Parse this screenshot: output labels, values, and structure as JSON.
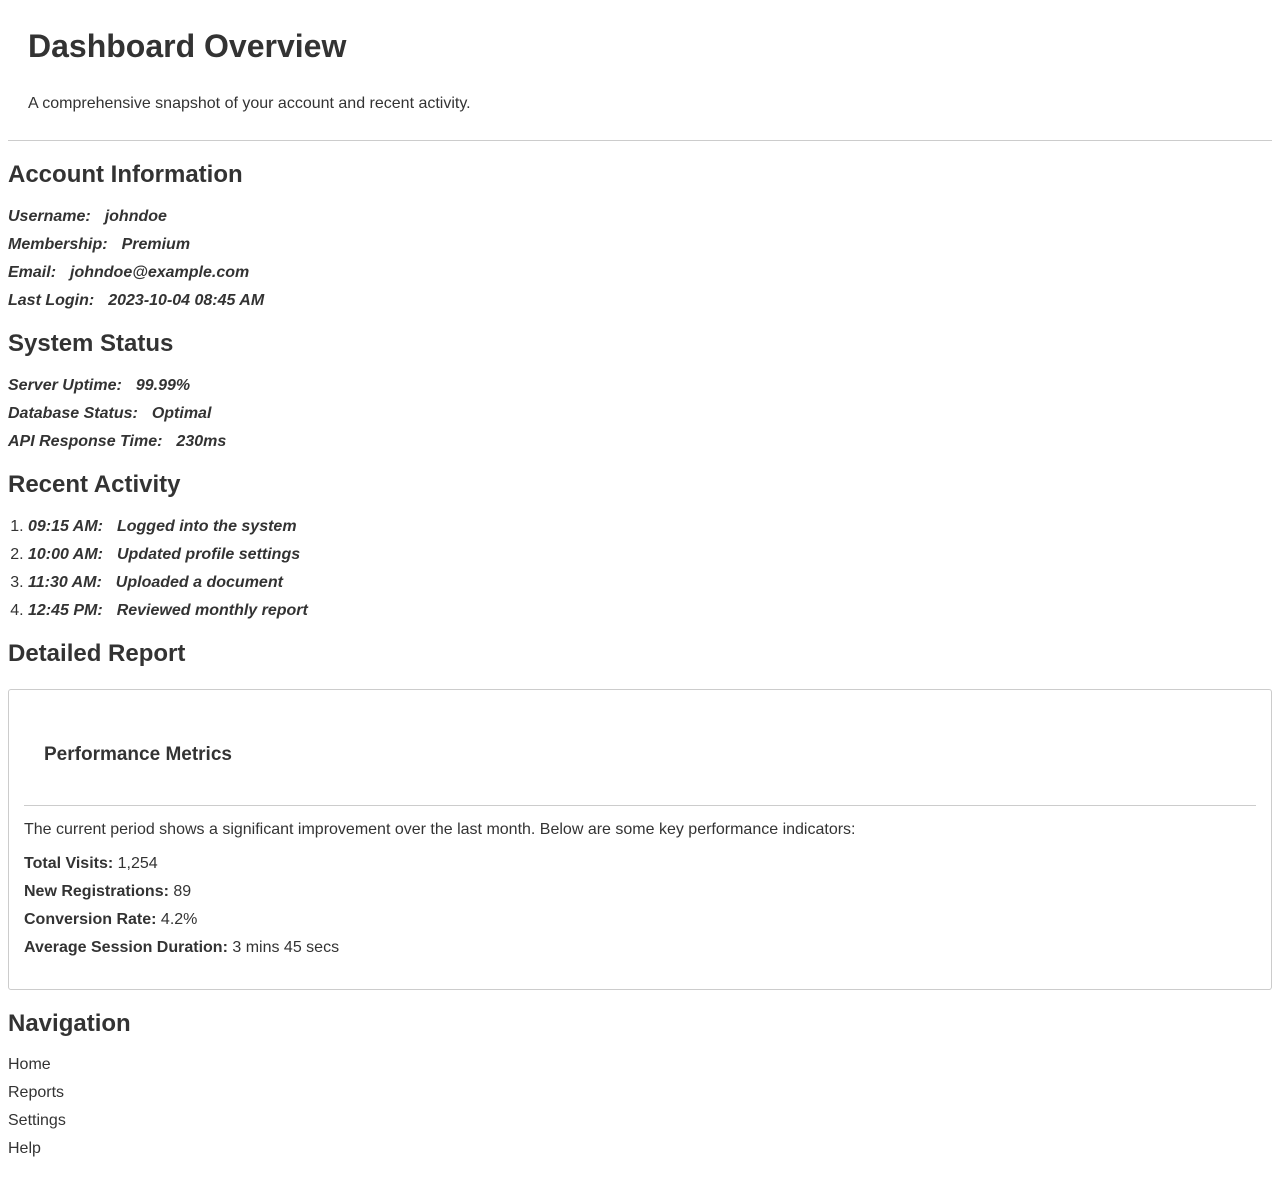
{
  "header": {
    "title": "Dashboard Overview",
    "subtitle": "A comprehensive snapshot of your account and recent activity."
  },
  "account": {
    "title": "Account Information",
    "rows": [
      {
        "label": "Username:",
        "value": "johndoe"
      },
      {
        "label": "Membership:",
        "value": "Premium"
      },
      {
        "label": "Email:",
        "value": "johndoe@example.com"
      },
      {
        "label": "Last Login:",
        "value": "2023-10-04 08:45 AM"
      }
    ]
  },
  "system": {
    "title": "System Status",
    "rows": [
      {
        "label": "Server Uptime:",
        "value": "99.99%"
      },
      {
        "label": "Database Status:",
        "value": "Optimal"
      },
      {
        "label": "API Response Time:",
        "value": "230ms"
      }
    ]
  },
  "activity": {
    "title": "Recent Activity",
    "items": [
      {
        "time": "09:15 AM:",
        "desc": "Logged into the system"
      },
      {
        "time": "10:00 AM:",
        "desc": "Updated profile settings"
      },
      {
        "time": "11:30 AM:",
        "desc": "Uploaded a document"
      },
      {
        "time": "12:45 PM:",
        "desc": "Reviewed monthly report"
      }
    ]
  },
  "report": {
    "title": "Detailed Report",
    "card_title": "Performance Metrics",
    "intro": "The current period shows a significant improvement over the last month. Below are some key performance indicators:",
    "metrics": [
      {
        "label": "Total Visits:",
        "value": "1,254"
      },
      {
        "label": "New Registrations:",
        "value": "89"
      },
      {
        "label": "Conversion Rate:",
        "value": "4.2%"
      },
      {
        "label": "Average Session Duration:",
        "value": "3 mins 45 secs"
      }
    ]
  },
  "navigation": {
    "title": "Navigation",
    "links": [
      "Home",
      "Reports",
      "Settings",
      "Help"
    ]
  }
}
